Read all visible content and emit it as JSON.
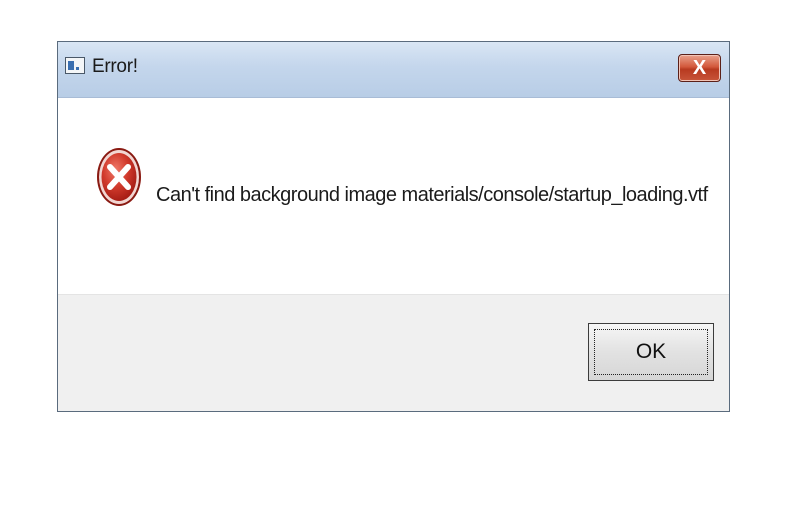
{
  "window": {
    "title": "Error!",
    "close_label": "X"
  },
  "dialog": {
    "icon": "error-icon",
    "message": "Can't find background image materials/console/startup_loading.vtf",
    "ok_label": "OK"
  },
  "colors": {
    "titlebar": "#c4d6ec",
    "close_button": "#c8553a",
    "error_icon": "#c62a2a",
    "footer": "#f0f0f0"
  }
}
